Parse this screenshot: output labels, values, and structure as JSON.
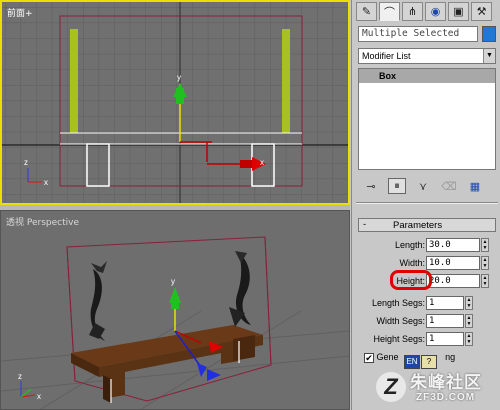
{
  "viewports": {
    "front": {
      "label": "前面+"
    },
    "perspective": {
      "label": "透视 Perspective"
    },
    "axis_x": "x",
    "axis_y": "y",
    "axis_z": "z"
  },
  "command_panel": {
    "tabs": [
      {
        "icon": "create-icon"
      },
      {
        "icon": "modify-icon"
      },
      {
        "icon": "hierarchy-icon"
      },
      {
        "icon": "motion-icon"
      },
      {
        "icon": "display-icon"
      },
      {
        "icon": "utilities-icon"
      }
    ],
    "name_field": "Multiple Selected",
    "selection_color": "#1e78d8",
    "modifier_list": "Modifier List",
    "stack": [
      "Box"
    ],
    "stack_tools": [
      "pin-stack-icon",
      "show-end-result-icon",
      "make-unique-icon",
      "remove-modifier-icon",
      "configure-modifier-sets-icon"
    ]
  },
  "parameters": {
    "title": "Parameters",
    "collapse": "-",
    "length_label": "Length:",
    "length_value": "30.0",
    "width_label": "Width:",
    "width_value": "10.0",
    "height_label": "Height:",
    "height_value": "20.0",
    "length_segs_label": "Length Segs:",
    "length_segs_value": "1",
    "width_segs_label": "Width Segs:",
    "width_segs_value": "1",
    "height_segs_label": "Height Segs:",
    "height_segs_value": "1",
    "generate_label_a": "Gene",
    "generate_label_b": "ng",
    "generate_checked": "✔"
  },
  "ime": {
    "lang": "EN",
    "help": "?"
  },
  "watermark": {
    "brand": "朱峰社区",
    "url": "ZF3D.COM"
  }
}
